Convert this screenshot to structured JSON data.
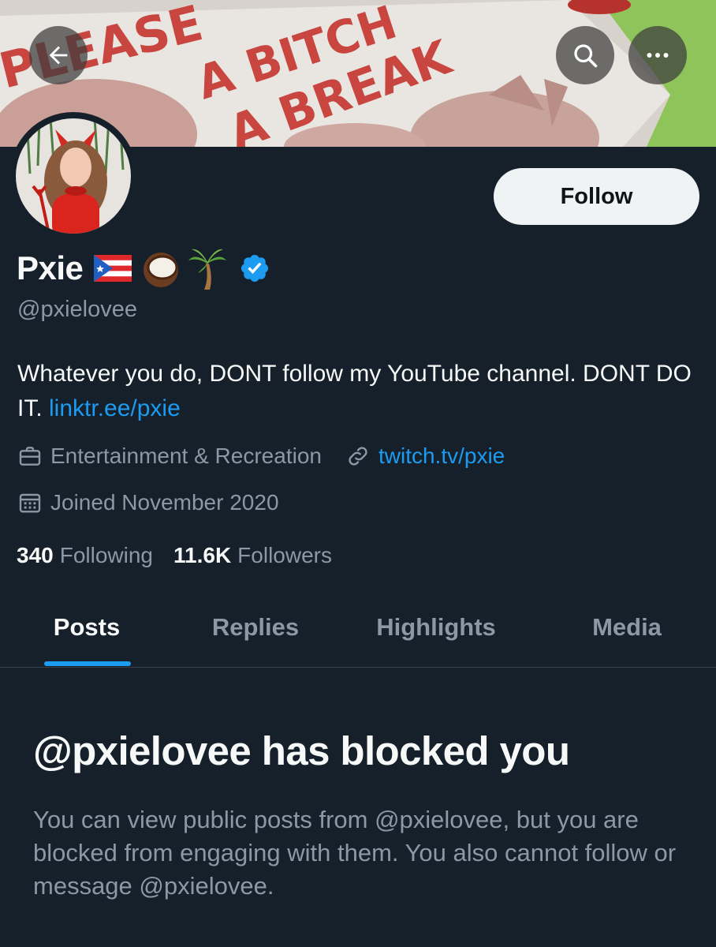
{
  "banner": {
    "text_lines": [
      "PLEASE",
      "A BITCH",
      "A BREAK"
    ]
  },
  "header": {
    "back_icon": "arrow-left-icon",
    "search_icon": "search-icon",
    "more_icon": "more-horizontal-icon"
  },
  "profile": {
    "display_name": "Pxie",
    "name_emojis": [
      "flag-puerto-rico",
      "coconut",
      "palm-tree"
    ],
    "verified_badge_color": "#1d9bf0",
    "handle": "@pxielovee",
    "follow_label": "Follow",
    "bio_text": "Whatever you do, DONT follow my YouTube channel. DONT DO IT. ",
    "bio_link": "linktr.ee/pxie",
    "category": "Entertainment & Recreation",
    "website": "twitch.tv/pxie",
    "joined": "Joined November 2020",
    "following_count": "340",
    "following_label": "Following",
    "followers_count": "11.6K",
    "followers_label": "Followers"
  },
  "tabs": [
    {
      "label": "Posts",
      "active": true
    },
    {
      "label": "Replies",
      "active": false
    },
    {
      "label": "Highlights",
      "active": false
    },
    {
      "label": "Media",
      "active": false
    }
  ],
  "blocked": {
    "title": "@pxielovee has blocked you",
    "description": "You can view public posts from @pxielovee, but you are blocked from engaging with them. You also cannot follow or message @pxielovee."
  },
  "colors": {
    "background": "#15202b",
    "accent": "#1d9bf0",
    "secondary_text": "#8b98a5",
    "primary_text": "#f7f9f9"
  }
}
